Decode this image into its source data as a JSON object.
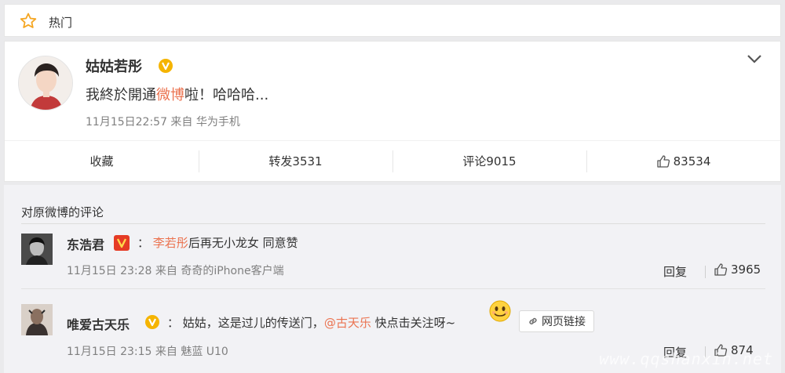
{
  "hot_bar": {
    "label": "热门"
  },
  "post": {
    "author": "姑姑若彤",
    "text_before": "我終於開通",
    "text_highlight": "微博",
    "text_after": "啦！哈哈哈...",
    "meta": "11月15日22:57 来自 华为手机",
    "actions": {
      "favorite": "收藏",
      "repost": "转发3531",
      "comment": "评论9015",
      "likes": "83534"
    }
  },
  "comments_section": {
    "title": "对原微博的评论",
    "comments": [
      {
        "name": "东浩君",
        "colon": "：",
        "mention": "李若彤",
        "text": "后再无小龙女 同意赞",
        "meta": "11月15日 23:28 来自 奇奇的iPhone客户端",
        "reply": "回复",
        "likes": "3965"
      },
      {
        "name": "唯爱古天乐",
        "colon": "：",
        "text_before": "姑姑，这是过儿的传送门，",
        "at": "@古天乐",
        "text_after": " 快点击关注呀~",
        "link_label": "网页链接",
        "meta": "11月15日 23:15 来自 魅蓝 U10",
        "reply": "回复",
        "likes": "874"
      }
    ]
  },
  "watermark": "www.qqshanxin.net",
  "colors": {
    "accent": "#eb7350",
    "vip_gold": "#f5b400",
    "vip_red": "#e53b25"
  }
}
